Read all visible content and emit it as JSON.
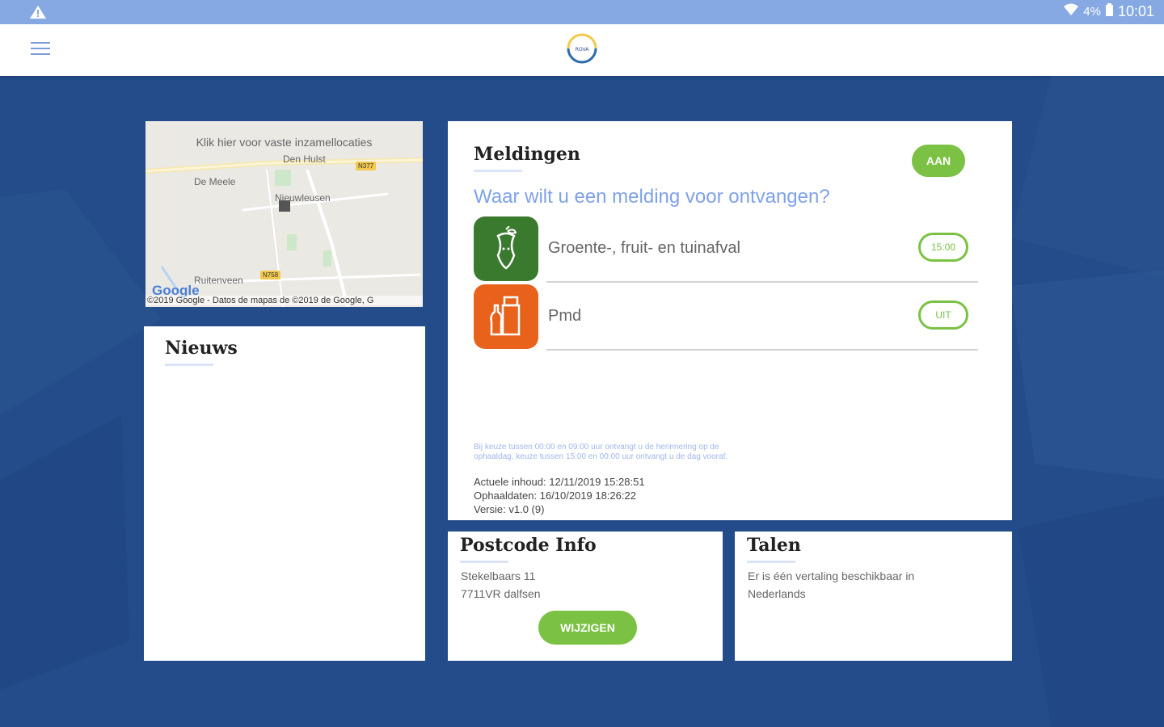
{
  "statusbar": {
    "battery": "4%",
    "time": "10:01"
  },
  "map": {
    "hint": "Klik hier voor vaste inzamellocaties",
    "labels": [
      "Den Hulst",
      "De Meele",
      "Nieuwleusen",
      "Ruitenveen"
    ],
    "badges": [
      "N377",
      "N758"
    ],
    "google": "Google",
    "copyright": "©2019 Google - Datos de mapas de ©2019 de Google, G"
  },
  "news": {
    "title": "Nieuws"
  },
  "meldingen": {
    "title": "Meldingen",
    "toggle": "AAN",
    "question": "Waar wilt u een melding voor ontvangen?",
    "items": [
      {
        "label": "Groente-, fruit- en tuinafval",
        "value": "15:00",
        "color": "#3a7a2e"
      },
      {
        "label": "Pmd",
        "value": "UIT",
        "color": "#e8621c"
      }
    ],
    "note": "Bij keuze tussen 00:00 en 09:00 uur ontvangt u de herinnering op de ophaaldag, keuze tussen 15:00 en 00:00 uur ontvangt u de dag vooraf.",
    "actuele": "Actuele inhoud: 12/11/2019 15:28:51",
    "ophaaldaten": "Ophaaldaten: 16/10/2019 18:26:22",
    "versie": "Versie: v1.0 (9)"
  },
  "postcode": {
    "title": "Postcode Info",
    "street": "Stekelbaars 11",
    "city": "7711VR dalfsen",
    "button": "WIJZIGEN"
  },
  "talen": {
    "title": "Talen",
    "text": "Er is één vertaling beschikbaar in Nederlands"
  },
  "colors": {
    "background": "#244b8a",
    "accent_green": "#7bc143",
    "accent_blue": "#7fa2e8",
    "statusbar": "#86a9e4"
  }
}
